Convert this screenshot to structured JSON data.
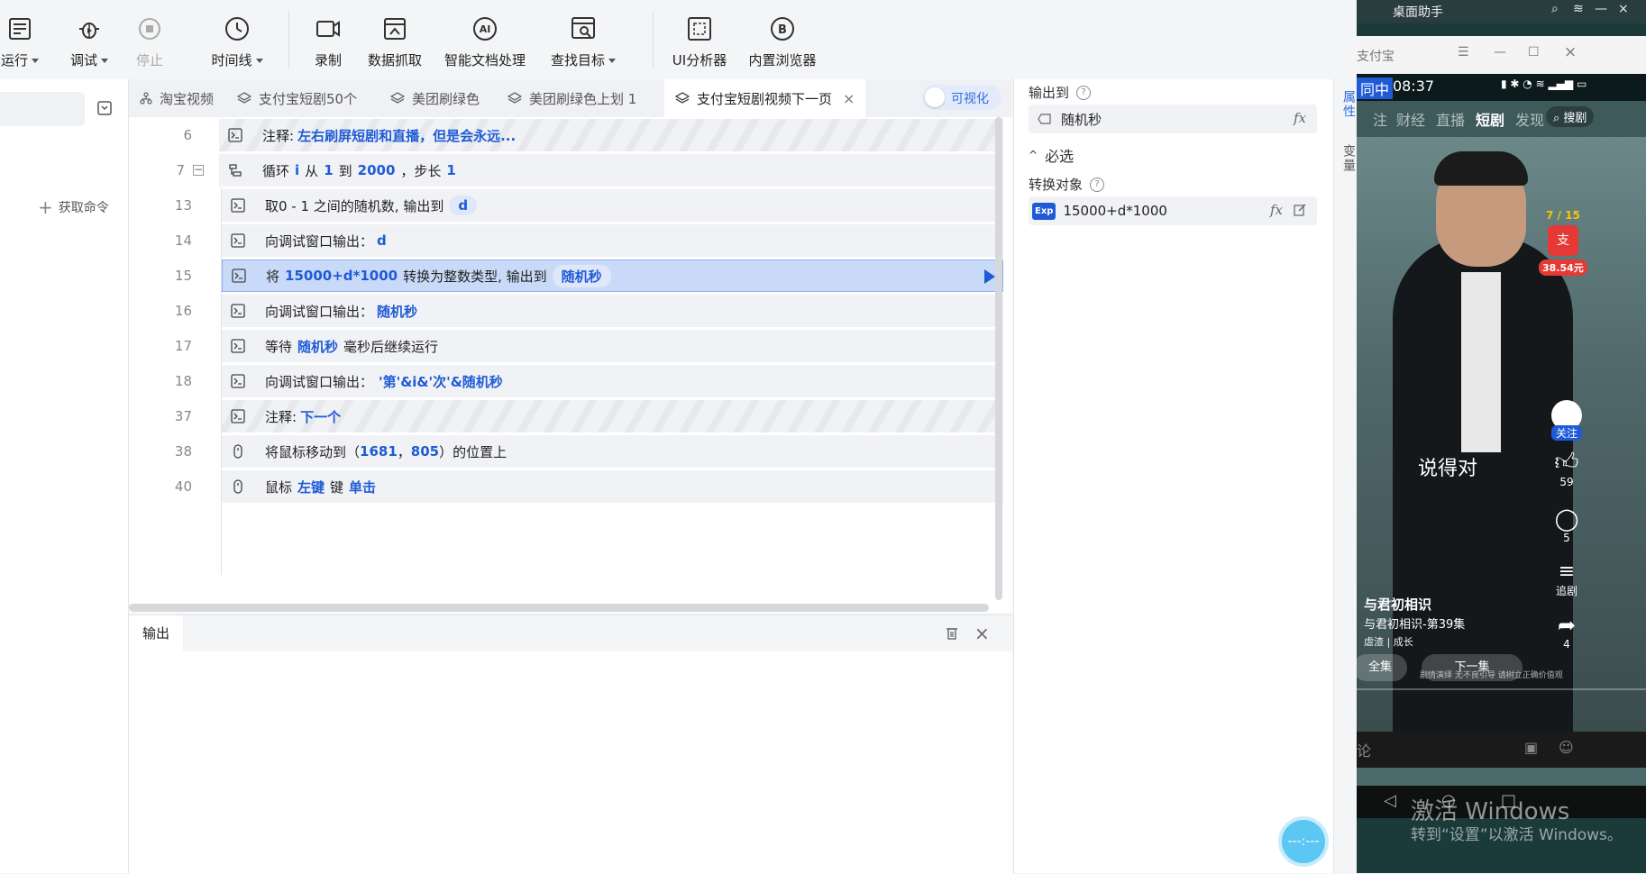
{
  "toolbar": {
    "run": "运行",
    "debug": "调试",
    "stop": "停止",
    "timeline": "时间线",
    "record": "录制",
    "data_capture": "数据抓取",
    "ai_doc": "智能文档处理",
    "find_target": "查找目标",
    "ui_analyzer": "UI分析器",
    "builtin_browser": "内置浏览器"
  },
  "left_panel": {
    "fetch_commands": "获取命令"
  },
  "tabs": [
    {
      "label": "淘宝视频"
    },
    {
      "label": "支付宝短剧50个"
    },
    {
      "label": "美团刷绿色"
    },
    {
      "label": "美团刷绿色上划 1"
    },
    {
      "label": "支付宝短剧视频下一页",
      "active": true
    }
  ],
  "visualize_toggle": "可视化",
  "editor": {
    "rows": [
      {
        "line": "6",
        "prefix": "注释:",
        "kw1": "左右刷屏短剧和直播，但是会永远...",
        "mid1": "",
        "kw2": "",
        "mid2": "",
        "kw3": "",
        "suffix": "",
        "chip": ""
      },
      {
        "line": "7",
        "prefix": "循环",
        "kw1": "i",
        "mid1": "从",
        "kw2": "1",
        "mid2": "到",
        "kw3": "2000",
        "suffix": "，步长",
        "kw4": "1",
        "chip": ""
      },
      {
        "line": "13",
        "prefix": "取0 - 1 之间的随机数, 输出到",
        "kw1": "",
        "mid1": "",
        "kw2": "",
        "mid2": "",
        "kw3": "",
        "suffix": "",
        "chip": "d"
      },
      {
        "line": "14",
        "prefix": "向调试窗口输出：",
        "kw1": "d",
        "mid1": "",
        "kw2": "",
        "mid2": "",
        "kw3": "",
        "suffix": "",
        "chip": ""
      },
      {
        "line": "15",
        "prefix": "将",
        "kw1": "15000+d*1000",
        "mid1": "转换为整数类型, 输出到",
        "kw2": "",
        "mid2": "",
        "kw3": "",
        "suffix": "",
        "chip": "随机秒"
      },
      {
        "line": "16",
        "prefix": "向调试窗口输出：",
        "kw1": "随机秒",
        "mid1": "",
        "kw2": "",
        "mid2": "",
        "kw3": "",
        "suffix": "",
        "chip": ""
      },
      {
        "line": "17",
        "prefix": "等待",
        "kw1": "随机秒",
        "mid1": "毫秒后继续运行",
        "kw2": "",
        "mid2": "",
        "kw3": "",
        "suffix": "",
        "chip": ""
      },
      {
        "line": "18",
        "prefix": "向调试窗口输出：",
        "kw1": "'第'&i&'次'&随机秒",
        "mid1": "",
        "kw2": "",
        "mid2": "",
        "kw3": "",
        "suffix": "",
        "chip": ""
      },
      {
        "line": "37",
        "prefix": "注释:",
        "kw1": "下一个",
        "mid1": "",
        "kw2": "",
        "mid2": "",
        "kw3": "",
        "suffix": "",
        "chip": ""
      },
      {
        "line": "38",
        "prefix": "将鼠标移动到（",
        "kw1": "1681",
        "mid1": "，",
        "kw2": "805",
        "mid2": "）的位置上",
        "kw3": "",
        "suffix": "",
        "chip": ""
      },
      {
        "line": "40",
        "prefix": "鼠标",
        "kw1": "左键",
        "mid1": "键",
        "kw2": "单击",
        "mid2": "",
        "kw3": "",
        "suffix": "",
        "chip": ""
      }
    ]
  },
  "output_panel": {
    "tab": "输出"
  },
  "properties": {
    "output_to_label": "输出到",
    "output_to_value": "随机秒",
    "required_section": "必选",
    "convert_label": "转换对象",
    "convert_badge": "Exp",
    "convert_value": "15000+d*1000",
    "fx": "fx"
  },
  "side_tabs": {
    "attributes": "属性",
    "variables": "变量"
  },
  "float_button": "---:---",
  "phone": {
    "top_title": "桌面助手",
    "window_title": "支付宝",
    "status_left": "同中",
    "time": "08:37",
    "nav": [
      "注",
      "财经",
      "直播",
      "短剧",
      "发现"
    ],
    "search": "搜剧",
    "counter": "7 / 15",
    "reward": "38.54元",
    "follow": "关注",
    "likes": "59",
    "comments": "5",
    "follow_drama": "追剧",
    "shares": "4",
    "subtitle": "说得对",
    "show_title": "与君初相识",
    "episode": "与君初相识-第39集",
    "tags": "虐渣 | 成长",
    "all_episodes": "全集",
    "next_episode": "下一集",
    "disclaimer": "剧情演绎 无不良引导 请树立正确价值观",
    "comment_placeholder": "论"
  },
  "watermark": {
    "line1": "激活 Windows",
    "line2": "转到“设置”以激活 Windows。"
  }
}
